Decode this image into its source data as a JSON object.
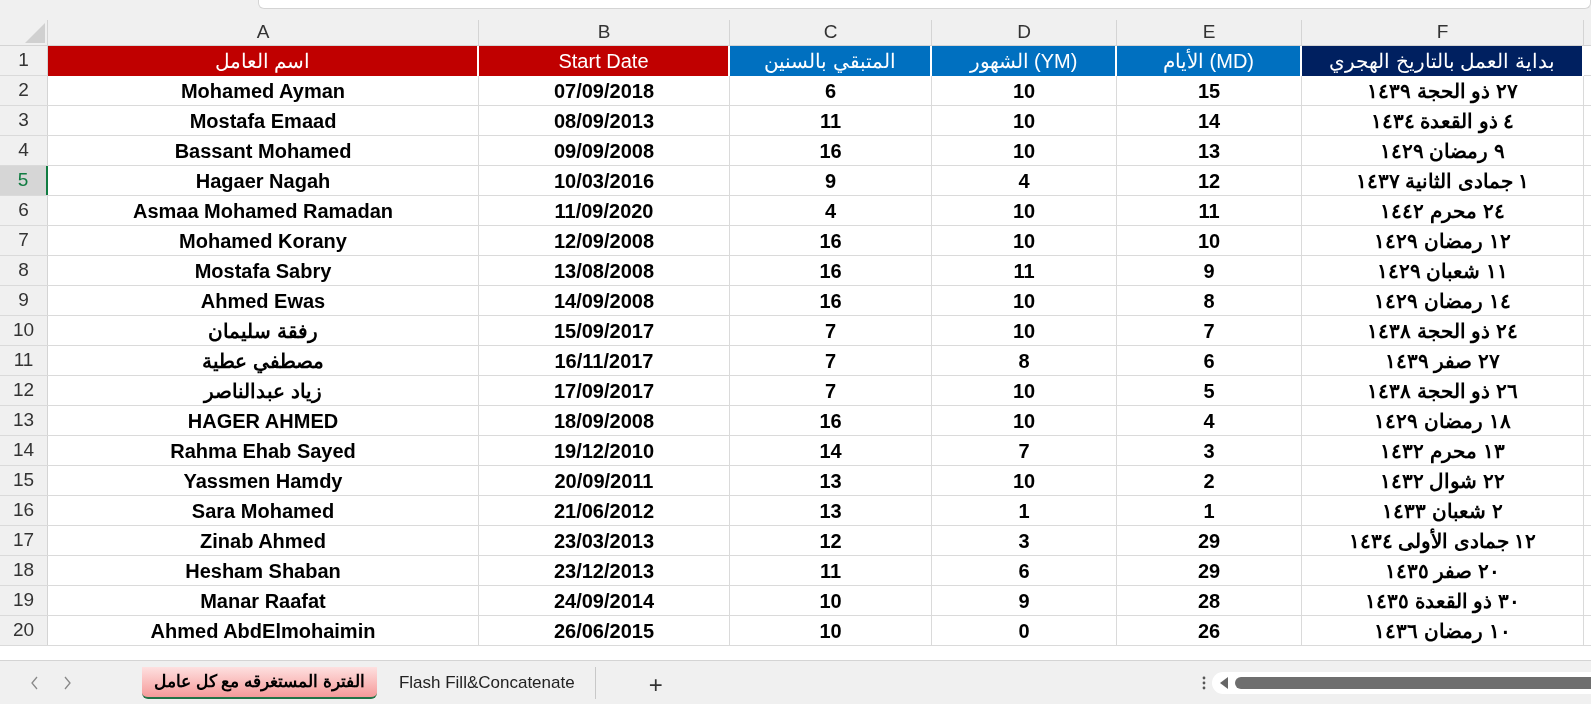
{
  "column_letters": [
    "F",
    "E",
    "D",
    "C",
    "B",
    "A"
  ],
  "rows": [
    {
      "number": "1",
      "selected": false,
      "kind": "header",
      "cells": [
        {
          "text": "بداية العمل بالتاريخ الهجري",
          "color": "#002060"
        },
        {
          "text": "الأيام (MD)",
          "color": "#0070c0"
        },
        {
          "text": "الشهور (YM)",
          "color": "#0070c0"
        },
        {
          "text": "المتبقي بالسنين",
          "color": "#0070c0"
        },
        {
          "text": "Start Date",
          "color": "#c00000"
        },
        {
          "text": "اسم العامل",
          "color": "#c00000"
        }
      ]
    },
    {
      "number": "2",
      "selected": false,
      "kind": "data",
      "cells": [
        {
          "text": "٢٧ ذو الحجة ١٤٣٩"
        },
        {
          "text": "15"
        },
        {
          "text": "10"
        },
        {
          "text": "6"
        },
        {
          "text": "07/09/2018"
        },
        {
          "text": "Mohamed Ayman"
        }
      ]
    },
    {
      "number": "3",
      "selected": false,
      "kind": "data",
      "cells": [
        {
          "text": "٤ ذو القعدة ١٤٣٤"
        },
        {
          "text": "14"
        },
        {
          "text": "10"
        },
        {
          "text": "11"
        },
        {
          "text": "08/09/2013"
        },
        {
          "text": "Mostafa Emaad"
        }
      ]
    },
    {
      "number": "4",
      "selected": false,
      "kind": "data",
      "cells": [
        {
          "text": "٩ رمضان ١٤٢٩"
        },
        {
          "text": "13"
        },
        {
          "text": "10"
        },
        {
          "text": "16"
        },
        {
          "text": "09/09/2008"
        },
        {
          "text": "Bassant Mohamed"
        }
      ]
    },
    {
      "number": "5",
      "selected": true,
      "kind": "data",
      "cells": [
        {
          "text": "١ جمادى الثانية ١٤٣٧"
        },
        {
          "text": "12"
        },
        {
          "text": "4"
        },
        {
          "text": "9"
        },
        {
          "text": "10/03/2016"
        },
        {
          "text": "Hagaer Nagah"
        }
      ]
    },
    {
      "number": "6",
      "selected": false,
      "kind": "data",
      "cells": [
        {
          "text": "٢٤ محرم ١٤٤٢"
        },
        {
          "text": "11"
        },
        {
          "text": "10"
        },
        {
          "text": "4"
        },
        {
          "text": "11/09/2020"
        },
        {
          "text": "Asmaa Mohamed Ramadan"
        }
      ]
    },
    {
      "number": "7",
      "selected": false,
      "kind": "data",
      "cells": [
        {
          "text": "١٢ رمضان ١٤٢٩"
        },
        {
          "text": "10"
        },
        {
          "text": "10"
        },
        {
          "text": "16"
        },
        {
          "text": "12/09/2008"
        },
        {
          "text": "Mohamed Korany"
        }
      ]
    },
    {
      "number": "8",
      "selected": false,
      "kind": "data",
      "cells": [
        {
          "text": "١١ شعبان ١٤٢٩"
        },
        {
          "text": "9"
        },
        {
          "text": "11"
        },
        {
          "text": "16"
        },
        {
          "text": "13/08/2008"
        },
        {
          "text": "Mostafa Sabry"
        }
      ]
    },
    {
      "number": "9",
      "selected": false,
      "kind": "data",
      "cells": [
        {
          "text": "١٤ رمضان ١٤٢٩"
        },
        {
          "text": "8"
        },
        {
          "text": "10"
        },
        {
          "text": "16"
        },
        {
          "text": "14/09/2008"
        },
        {
          "text": "Ahmed Ewas"
        }
      ]
    },
    {
      "number": "10",
      "selected": false,
      "kind": "data",
      "cells": [
        {
          "text": "٢٤ ذو الحجة ١٤٣٨"
        },
        {
          "text": "7"
        },
        {
          "text": "10"
        },
        {
          "text": "7"
        },
        {
          "text": "15/09/2017"
        },
        {
          "text": "رفقة سليمان"
        }
      ]
    },
    {
      "number": "11",
      "selected": false,
      "kind": "data",
      "cells": [
        {
          "text": "٢٧ صفر ١٤٣٩"
        },
        {
          "text": "6"
        },
        {
          "text": "8"
        },
        {
          "text": "7"
        },
        {
          "text": "16/11/2017"
        },
        {
          "text": "مصطفي عطية"
        }
      ]
    },
    {
      "number": "12",
      "selected": false,
      "kind": "data",
      "cells": [
        {
          "text": "٢٦ ذو الحجة ١٤٣٨"
        },
        {
          "text": "5"
        },
        {
          "text": "10"
        },
        {
          "text": "7"
        },
        {
          "text": "17/09/2017"
        },
        {
          "text": "زياد عبدالناصر"
        }
      ]
    },
    {
      "number": "13",
      "selected": false,
      "kind": "data",
      "cells": [
        {
          "text": "١٨ رمضان ١٤٢٩"
        },
        {
          "text": "4"
        },
        {
          "text": "10"
        },
        {
          "text": "16"
        },
        {
          "text": "18/09/2008"
        },
        {
          "text": "HAGER AHMED"
        }
      ]
    },
    {
      "number": "14",
      "selected": false,
      "kind": "data",
      "cells": [
        {
          "text": "١٣ محرم ١٤٣٢"
        },
        {
          "text": "3"
        },
        {
          "text": "7"
        },
        {
          "text": "14"
        },
        {
          "text": "19/12/2010"
        },
        {
          "text": "Rahma Ehab Sayed"
        }
      ]
    },
    {
      "number": "15",
      "selected": false,
      "kind": "data",
      "cells": [
        {
          "text": "٢٢ شوال ١٤٣٢"
        },
        {
          "text": "2"
        },
        {
          "text": "10"
        },
        {
          "text": "13"
        },
        {
          "text": "20/09/2011"
        },
        {
          "text": "Yassmen Hamdy"
        }
      ]
    },
    {
      "number": "16",
      "selected": false,
      "kind": "data",
      "cells": [
        {
          "text": "٢ شعبان ١٤٣٣"
        },
        {
          "text": "1"
        },
        {
          "text": "1"
        },
        {
          "text": "13"
        },
        {
          "text": "21/06/2012"
        },
        {
          "text": "Sara Mohamed"
        }
      ]
    },
    {
      "number": "17",
      "selected": false,
      "kind": "data",
      "cells": [
        {
          "text": "١٢ جمادى الأولى ١٤٣٤"
        },
        {
          "text": "29"
        },
        {
          "text": "3"
        },
        {
          "text": "12"
        },
        {
          "text": "23/03/2013"
        },
        {
          "text": "Zinab Ahmed"
        }
      ]
    },
    {
      "number": "18",
      "selected": false,
      "kind": "data",
      "cells": [
        {
          "text": "٢٠ صفر ١٤٣٥"
        },
        {
          "text": "29"
        },
        {
          "text": "6"
        },
        {
          "text": "11"
        },
        {
          "text": "23/12/2013"
        },
        {
          "text": "Hesham Shaban"
        }
      ]
    },
    {
      "number": "19",
      "selected": false,
      "kind": "data",
      "cells": [
        {
          "text": "٣٠ ذو القعدة ١٤٣٥"
        },
        {
          "text": "28"
        },
        {
          "text": "9"
        },
        {
          "text": "10"
        },
        {
          "text": "24/09/2014"
        },
        {
          "text": "Manar Raafat"
        }
      ]
    },
    {
      "number": "20",
      "selected": false,
      "kind": "data",
      "cells": [
        {
          "text": "١٠ رمضان ١٤٣٦"
        },
        {
          "text": "26"
        },
        {
          "text": "0"
        },
        {
          "text": "10"
        },
        {
          "text": "26/06/2015"
        },
        {
          "text": "Ahmed AbdElmohaimin"
        }
      ]
    }
  ],
  "sheet_tabs": [
    {
      "label": "Flash Fill&Concatenate",
      "selected": false
    },
    {
      "label": "الفترة المستغرقه مع كل عامل",
      "selected": true
    }
  ],
  "add_sheet": "+"
}
